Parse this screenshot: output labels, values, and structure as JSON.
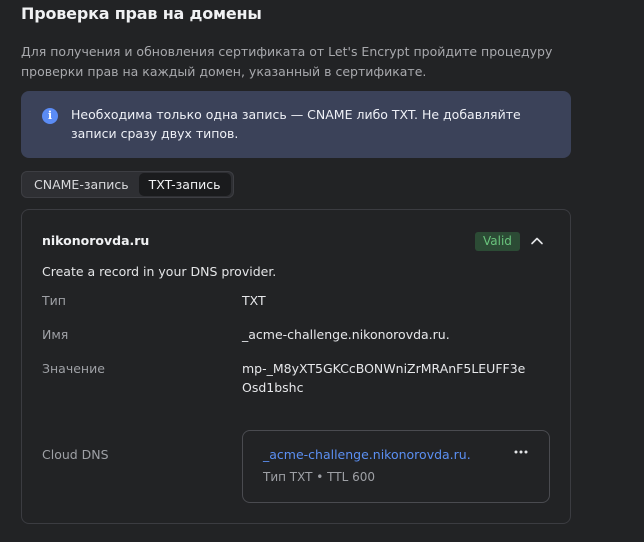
{
  "header": {
    "title": "Проверка прав на домены",
    "description": "Для получения и обновления сертификата от Let's Encrypt пройдите процедуру проверки прав на каждый домен, указанный в сертификате."
  },
  "notice": {
    "icon": "info-icon",
    "text": "Необходима только одна запись — CNAME либо TXT. Не добавляйте записи сразу двух типов."
  },
  "tabs": [
    {
      "label": "CNAME-запись",
      "active": false
    },
    {
      "label": "TXT-запись",
      "active": true
    }
  ],
  "card": {
    "domain": "nikonorovda.ru",
    "status": "Valid",
    "hint": "Create a record in your DNS provider.",
    "rows": {
      "type": {
        "label": "Тип",
        "value": "TXT"
      },
      "name": {
        "label": "Имя",
        "value": "_acme-challenge.nikonorovda.ru."
      },
      "value": {
        "label": "Значение",
        "value": "mp-_M8yXT5GKCcBONWniZrMRAnF5LEUFF3eOsd1bshc"
      },
      "cloud_dns": {
        "label": "Cloud DNS"
      }
    },
    "dns_record": {
      "link": "_acme-challenge.nikonorovda.ru.",
      "meta": "Тип TXT • TTL 600"
    }
  },
  "colors": {
    "background": "#222325",
    "notice_bg": "#3b4259",
    "accent": "#5b8ff2",
    "valid_bg": "#2c4b35",
    "valid_text": "#69c37c"
  }
}
